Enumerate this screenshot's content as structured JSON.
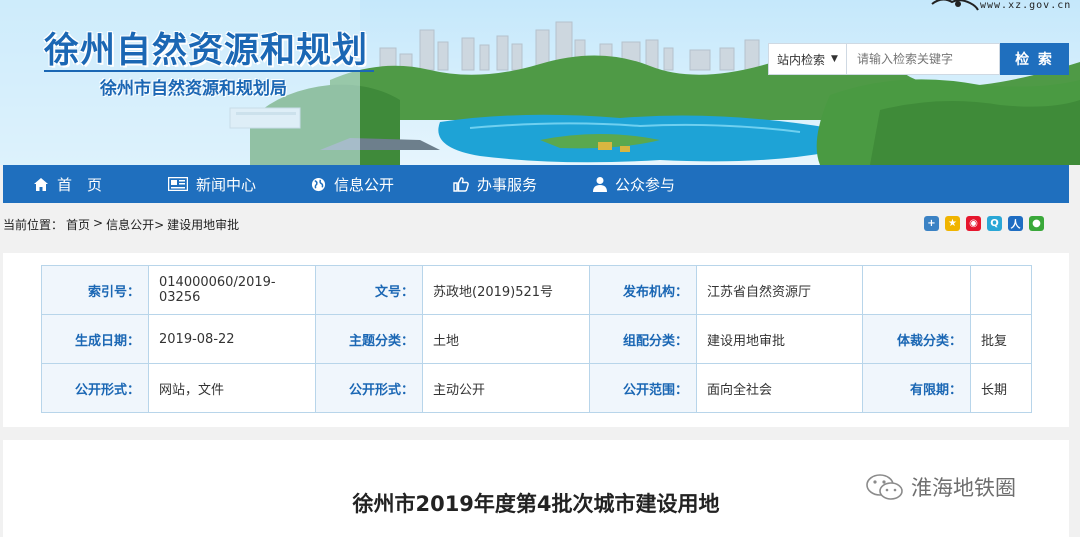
{
  "header": {
    "title": "徐州自然资源和规划",
    "subtitle": "徐州市自然资源和规划局",
    "domain": "www.xz.gov.cn"
  },
  "search": {
    "scope_label": "站内检索",
    "placeholder": "请输入检索关键字",
    "button_label": "检 索"
  },
  "nav": {
    "items": [
      {
        "label": "首　页",
        "icon": "home-icon"
      },
      {
        "label": "新闻中心",
        "icon": "newspaper-icon"
      },
      {
        "label": "信息公开",
        "icon": "globe-icon"
      },
      {
        "label": "办事服务",
        "icon": "thumbs-up-icon"
      },
      {
        "label": "公众参与",
        "icon": "user-icon"
      }
    ]
  },
  "breadcrumb": {
    "prefix": "当前位置：",
    "items": [
      "首页",
      ">",
      "信息公开>",
      "建设用地审批"
    ]
  },
  "share_icons": [
    {
      "name": "share-add-icon",
      "color": "#3b82c4"
    },
    {
      "name": "share-qzone-icon",
      "color": "#f0b400"
    },
    {
      "name": "share-weibo-icon",
      "color": "#e6162d"
    },
    {
      "name": "share-tencent-weibo-icon",
      "color": "#2aa7d6"
    },
    {
      "name": "share-renren-icon",
      "color": "#1e6dc2"
    },
    {
      "name": "share-wechat-icon",
      "color": "#3aa83a"
    }
  ],
  "info": {
    "rows": [
      [
        {
          "key": "索引号：",
          "value": "014000060/2019-03256"
        },
        {
          "key": "文号：",
          "value": "苏政地(2019)521号"
        },
        {
          "key": "发布机构：",
          "value": "江苏省自然资源厅"
        },
        {
          "key": "",
          "value": ""
        }
      ],
      [
        {
          "key": "生成日期：",
          "value": "2019-08-22"
        },
        {
          "key": "主题分类：",
          "value": "土地"
        },
        {
          "key": "组配分类：",
          "value": "建设用地审批"
        },
        {
          "key": "体裁分类：",
          "value": "批复"
        }
      ],
      [
        {
          "key": "公开形式：",
          "value": "网站，文件"
        },
        {
          "key": "公开形式：",
          "value": "主动公开"
        },
        {
          "key": "公开范围：",
          "value": "面向全社会"
        },
        {
          "key": "有限期：",
          "value": "长期"
        }
      ]
    ]
  },
  "article": {
    "title": "徐州市2019年度第4批次城市建设用地"
  },
  "watermark": {
    "text": "淮海地铁圈"
  },
  "colors": {
    "brand_blue": "#1f6fbe",
    "title_blue": "#1b67b4",
    "table_border": "#b8d5ea"
  }
}
